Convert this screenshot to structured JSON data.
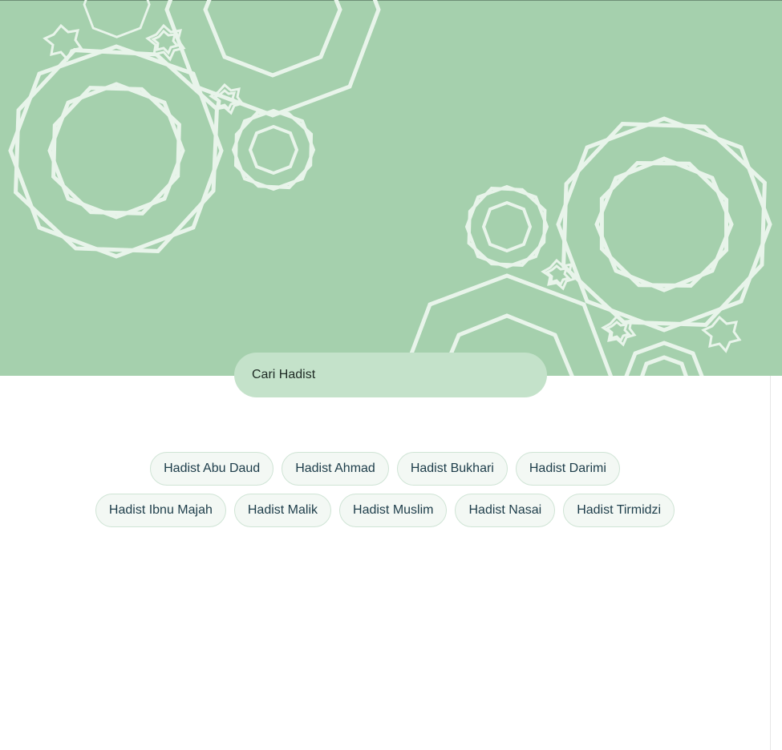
{
  "search": {
    "placeholder": "Cari Hadist"
  },
  "hadith_collections": {
    "row1": [
      {
        "label": "Hadist Abu Daud"
      },
      {
        "label": "Hadist Ahmad"
      },
      {
        "label": "Hadist Bukhari"
      },
      {
        "label": "Hadist Darimi"
      }
    ],
    "row2": [
      {
        "label": "Hadist Ibnu Majah"
      },
      {
        "label": "Hadist Malik"
      },
      {
        "label": "Hadist Muslim"
      },
      {
        "label": "Hadist Nasai"
      },
      {
        "label": "Hadist Tirmidzi"
      }
    ]
  },
  "colors": {
    "hero_background": "#a5d0ad",
    "search_background": "#c4e2ca",
    "chip_background": "#f3f8f4",
    "chip_text": "#1d3d4a",
    "ornament_stroke": "#e8f4ea"
  },
  "icons": {
    "hero_decoration": "islamic-star-ornament-icon"
  }
}
